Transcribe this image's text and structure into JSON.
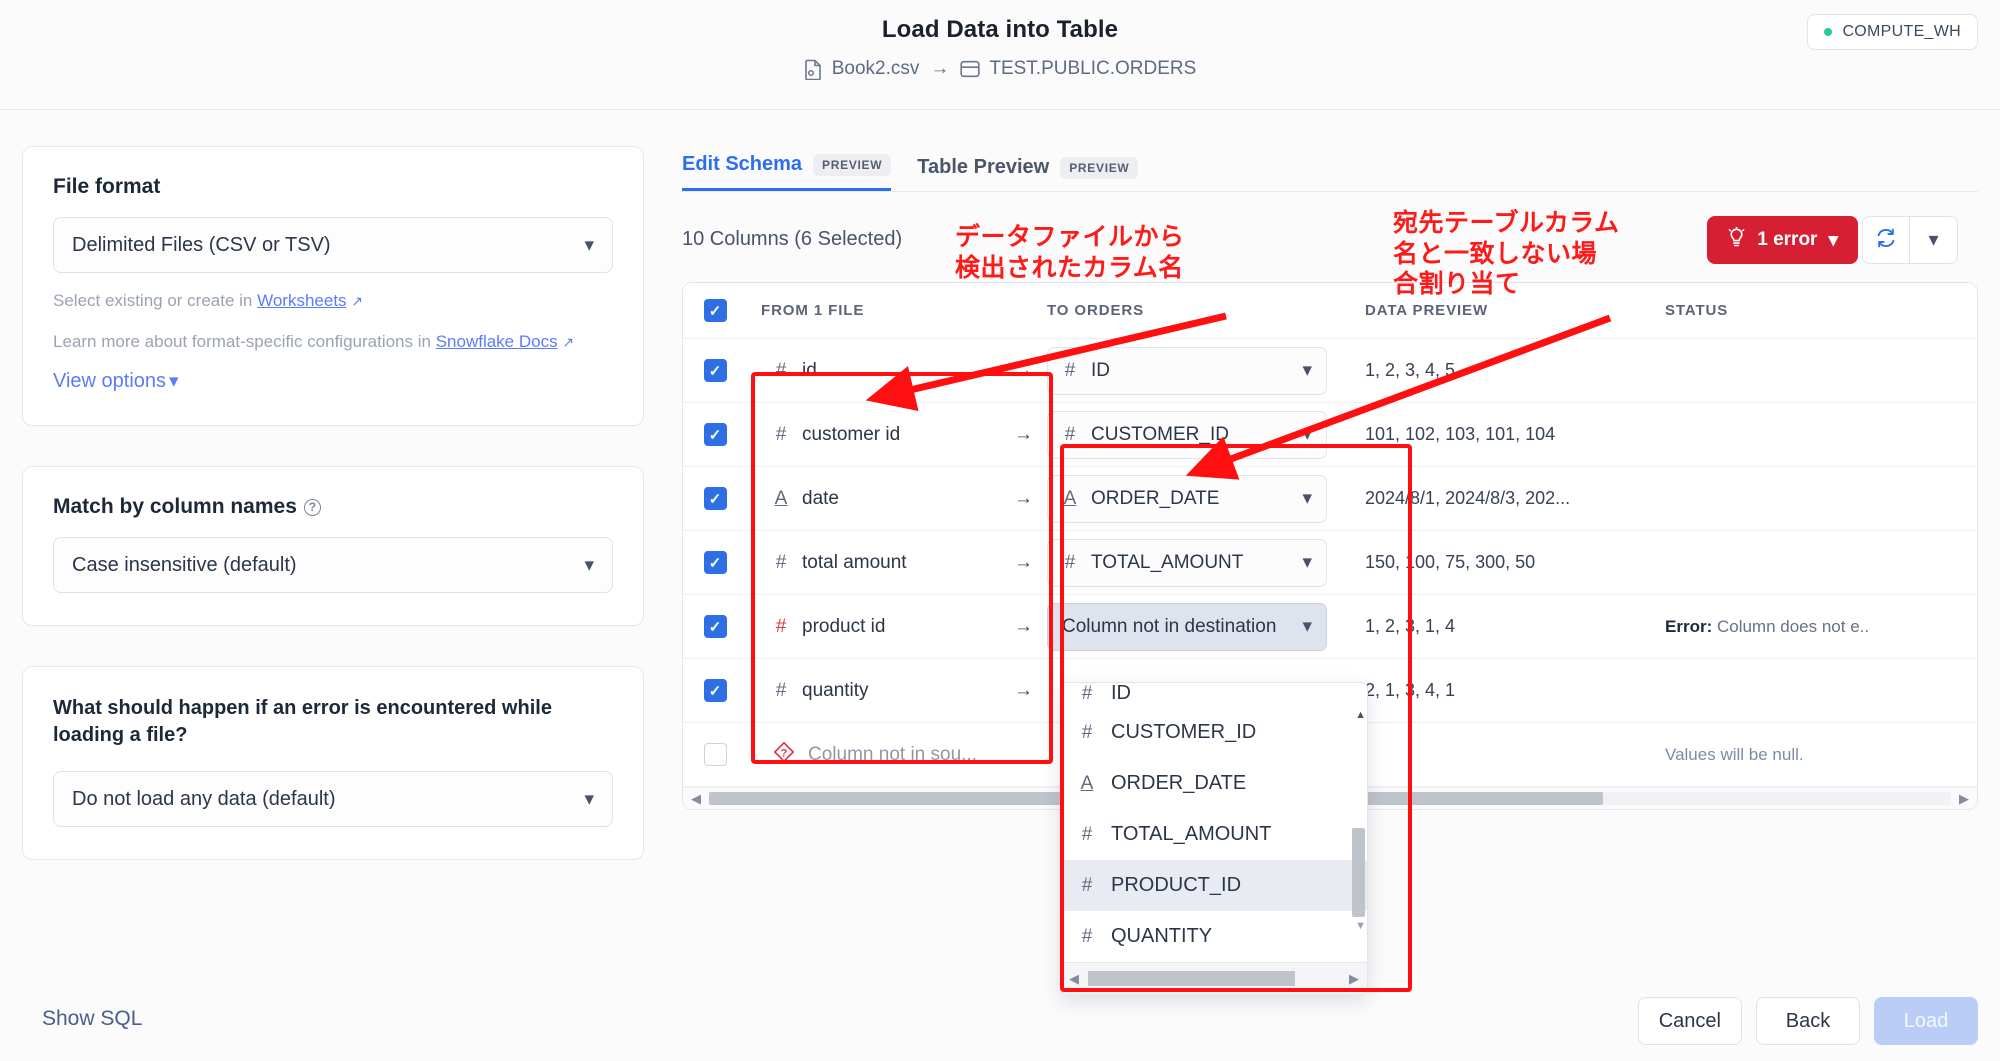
{
  "header": {
    "title": "Load Data into Table",
    "source_file": "Book2.csv",
    "arrow": "→",
    "destination": "TEST.PUBLIC.ORDERS",
    "warehouse": "COMPUTE_WH"
  },
  "sidebar": {
    "file_format": {
      "label": "File format",
      "value": "Delimited Files (CSV or TSV)",
      "hint_prefix": "Select existing or create in ",
      "hint_link": "Worksheets",
      "docs_prefix": "Learn more about format-specific configurations in ",
      "docs_link": "Snowflake Docs",
      "view_options": "View options"
    },
    "match_by": {
      "label": "Match by column names",
      "value": "Case insensitive (default)"
    },
    "on_error": {
      "label": "What should happen if an error is encountered while loading a file?",
      "value": "Do not load any data (default)"
    }
  },
  "main": {
    "tabs": [
      {
        "label": "Edit Schema",
        "badge": "PREVIEW",
        "active": true
      },
      {
        "label": "Table Preview",
        "badge": "PREVIEW",
        "active": false
      }
    ],
    "column_count": "10 Columns (6 Selected)",
    "error_button": "1 error",
    "refresh_icon": "refresh-icon",
    "table": {
      "headers": [
        "FROM 1 FILE",
        "TO ORDERS",
        "DATA PREVIEW",
        "STATUS"
      ],
      "rows": [
        {
          "checked": true,
          "src_type": "#",
          "src_type_color": "normal",
          "source": "id",
          "dest": "ID",
          "dest_state": "normal",
          "preview": "1, 2, 3, 4, 5",
          "status": "",
          "status_label": ""
        },
        {
          "checked": true,
          "src_type": "#",
          "src_type_color": "normal",
          "source": "customer id",
          "dest": "CUSTOMER_ID",
          "dest_state": "normal",
          "preview": "101, 102, 103, 101, 104",
          "status": "",
          "status_label": ""
        },
        {
          "checked": true,
          "src_type": "A",
          "src_type_color": "normal",
          "source": "date",
          "dest": "ORDER_DATE",
          "dest_state": "normal",
          "preview": "2024/8/1, 2024/8/3, 202...",
          "status": "",
          "status_label": ""
        },
        {
          "checked": true,
          "src_type": "#",
          "src_type_color": "normal",
          "source": "total amount",
          "dest": "TOTAL_AMOUNT",
          "dest_state": "normal",
          "preview": "150, 100, 75, 300, 50",
          "status": "",
          "status_label": ""
        },
        {
          "checked": true,
          "src_type": "#",
          "src_type_color": "red",
          "source": "product id",
          "dest": "Column not in destination",
          "dest_state": "active",
          "preview": "1, 2, 3, 1, 4",
          "status": "Column does not e..",
          "status_label": "Error:"
        },
        {
          "checked": true,
          "src_type": "#",
          "src_type_color": "normal",
          "source": "quantity",
          "dest": "",
          "dest_state": "hidden",
          "preview": "2, 1, 3, 4, 1",
          "status": "",
          "status_label": ""
        },
        {
          "checked": false,
          "src_type": "?",
          "src_type_color": "red",
          "source": "Column not in sou...",
          "dest": "",
          "dest_state": "hidden",
          "preview": "",
          "status": "Values will be null.",
          "status_label": ""
        }
      ]
    },
    "dropdown": {
      "items": [
        {
          "type": "#",
          "label": "ID",
          "highlighted": false,
          "clipped": true
        },
        {
          "type": "#",
          "label": "CUSTOMER_ID",
          "highlighted": false,
          "clipped": false
        },
        {
          "type": "A",
          "label": "ORDER_DATE",
          "highlighted": false,
          "clipped": false
        },
        {
          "type": "#",
          "label": "TOTAL_AMOUNT",
          "highlighted": false,
          "clipped": false
        },
        {
          "type": "#",
          "label": "PRODUCT_ID",
          "highlighted": true,
          "clipped": false
        },
        {
          "type": "#",
          "label": "QUANTITY",
          "highlighted": false,
          "clipped": false
        }
      ]
    }
  },
  "footer": {
    "show_sql": "Show SQL",
    "cancel": "Cancel",
    "back": "Back",
    "load": "Load"
  },
  "annotations": [
    {
      "id": "source-col-note",
      "text": "データファイルから\n検出されたカラム名"
    },
    {
      "id": "dest-col-note",
      "text": "宛先テーブルカラム\n名と一致しない場\n合割り当て"
    }
  ],
  "colors": {
    "accent_blue": "#2b6ff0",
    "error_red": "#d61f33",
    "annotation_red": "#ff0f0f",
    "warehouse_green": "#2ec4a0",
    "link_blue": "#5b7cfa"
  }
}
